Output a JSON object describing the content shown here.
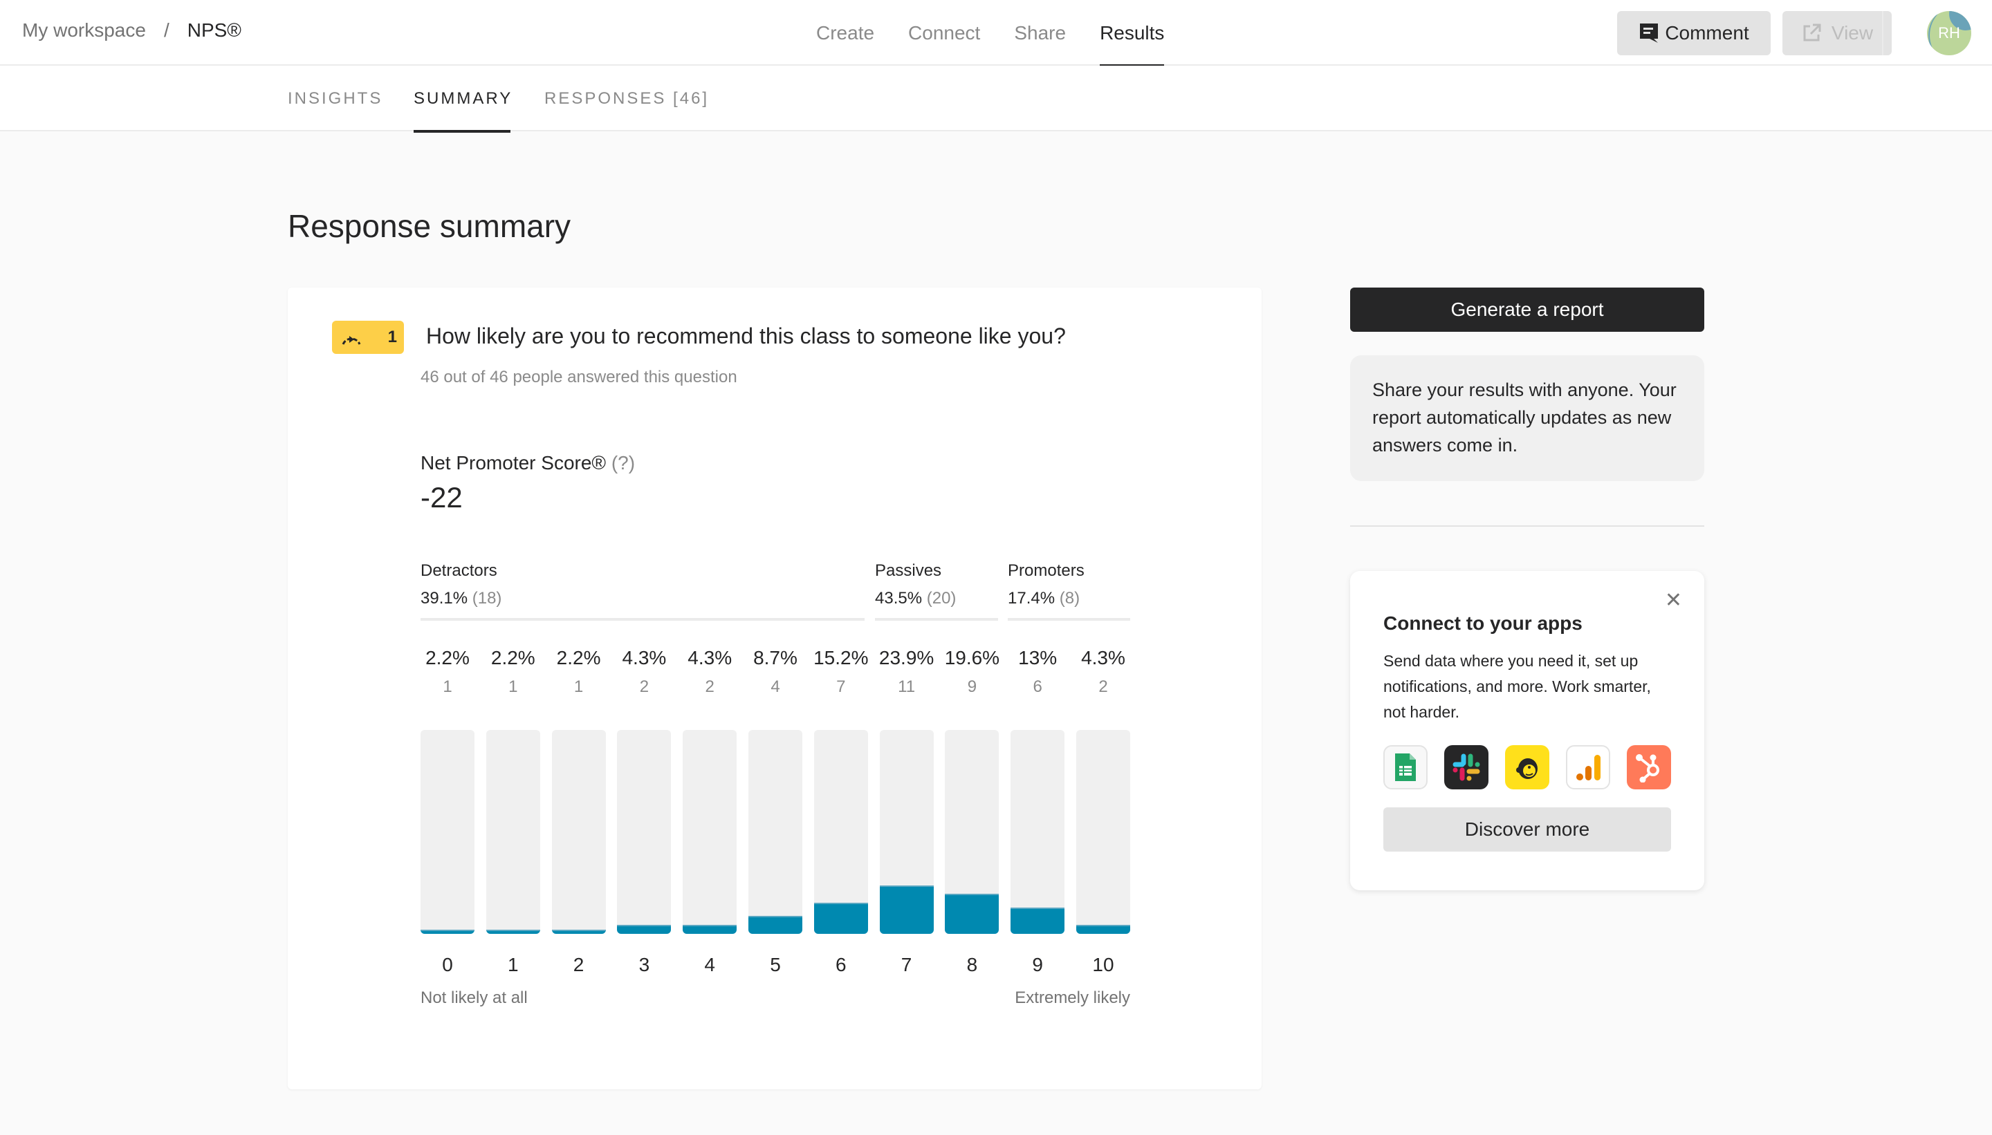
{
  "breadcrumb": {
    "workspace": "My workspace",
    "separator": "/",
    "form": "NPS®"
  },
  "main_nav": [
    {
      "label": "Create",
      "active": false
    },
    {
      "label": "Connect",
      "active": false
    },
    {
      "label": "Share",
      "active": false
    },
    {
      "label": "Results",
      "active": true
    }
  ],
  "header_actions": {
    "comment_label": "Comment",
    "comment_icon": "comment-icon",
    "view_label": "View",
    "view_icon": "external-link-icon",
    "view_disabled": true,
    "avatar_initials": "RH"
  },
  "sub_tabs": [
    {
      "label": "INSIGHTS",
      "active": false
    },
    {
      "label": "SUMMARY",
      "active": true
    },
    {
      "label": "RESPONSES [46]",
      "active": false
    }
  ],
  "page_title": "Response summary",
  "question": {
    "number": "1",
    "type_icon": "gauge-icon",
    "badge_color": "#fdcf48",
    "title": "How likely are you to recommend this class to someone like you?",
    "answered": "46 out of 46 people answered this question",
    "nps_label": "Net Promoter Score®",
    "nps_help": "(?)",
    "nps_value": "-22",
    "groups": [
      {
        "name": "Detractors",
        "percent": "39.1%",
        "count": "(18)"
      },
      {
        "name": "Passives",
        "percent": "43.5%",
        "count": "(20)"
      },
      {
        "name": "Promoters",
        "percent": "17.4%",
        "count": "(8)"
      }
    ],
    "scale_low_label": "Not likely at all",
    "scale_high_label": "Extremely likely"
  },
  "chart_data": {
    "type": "bar",
    "title": "How likely are you to recommend this class to someone like you?",
    "categories": [
      "0",
      "1",
      "2",
      "3",
      "4",
      "5",
      "6",
      "7",
      "8",
      "9",
      "10"
    ],
    "percent_labels": [
      "2.2%",
      "2.2%",
      "2.2%",
      "4.3%",
      "4.3%",
      "8.7%",
      "15.2%",
      "23.9%",
      "19.6%",
      "13%",
      "4.3%"
    ],
    "values_percent": [
      2.2,
      2.2,
      2.2,
      4.3,
      4.3,
      8.7,
      15.2,
      23.9,
      19.6,
      13,
      4.3
    ],
    "counts": [
      1,
      1,
      1,
      2,
      2,
      4,
      7,
      11,
      9,
      6,
      2
    ],
    "xlabel": "",
    "ylabel": "",
    "ylim": [
      0,
      100
    ],
    "bar_color": "#0089b0",
    "track_color": "#f0f0f0",
    "grid": false
  },
  "sidebar": {
    "report_button": "Generate a report",
    "share_text": "Share your results with anyone. Your report automatically updates as new answers come in.",
    "connect": {
      "title": "Connect to your apps",
      "description": "Send data where you need it, set up notifications, and more. Work smarter, not harder.",
      "close_icon": "close-icon",
      "apps": [
        {
          "name": "Google Sheets",
          "icon": "google-sheets-icon"
        },
        {
          "name": "Slack",
          "icon": "slack-icon"
        },
        {
          "name": "Mailchimp",
          "icon": "mailchimp-icon"
        },
        {
          "name": "Google Analytics",
          "icon": "google-analytics-icon"
        },
        {
          "name": "HubSpot",
          "icon": "hubspot-icon"
        }
      ],
      "discover_button": "Discover more"
    }
  }
}
